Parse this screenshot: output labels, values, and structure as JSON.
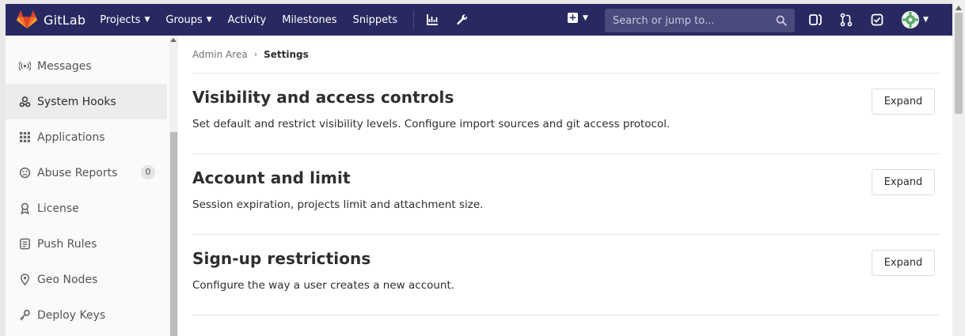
{
  "brand": {
    "name": "GitLab"
  },
  "nav": {
    "links": [
      {
        "label": "Projects",
        "caret": true
      },
      {
        "label": "Groups",
        "caret": true
      },
      {
        "label": "Activity",
        "caret": false
      },
      {
        "label": "Milestones",
        "caret": false
      },
      {
        "label": "Snippets",
        "caret": false
      }
    ],
    "icons": [
      "chart-icon",
      "wrench-icon"
    ]
  },
  "search": {
    "placeholder": "Search or jump to..."
  },
  "header_icons": [
    "issues-icon",
    "merge-requests-icon",
    "todos-icon"
  ],
  "sidebar": {
    "items": [
      {
        "label": "Messages",
        "icon": "broadcast-icon",
        "active": false
      },
      {
        "label": "System Hooks",
        "icon": "hook-icon",
        "active": true
      },
      {
        "label": "Applications",
        "icon": "grid-icon",
        "active": false
      },
      {
        "label": "Abuse Reports",
        "icon": "face-icon",
        "active": false,
        "badge": "0"
      },
      {
        "label": "License",
        "icon": "license-icon",
        "active": false
      },
      {
        "label": "Push Rules",
        "icon": "push-rules-icon",
        "active": false
      },
      {
        "label": "Geo Nodes",
        "icon": "location-icon",
        "active": false
      },
      {
        "label": "Deploy Keys",
        "icon": "key-icon",
        "active": false
      }
    ]
  },
  "breadcrumb": {
    "parent": "Admin Area",
    "current": "Settings"
  },
  "sections": [
    {
      "title": "Visibility and access controls",
      "description": "Set default and restrict visibility levels. Configure import sources and git access protocol.",
      "button": "Expand"
    },
    {
      "title": "Account and limit",
      "description": "Session expiration, projects limit and attachment size.",
      "button": "Expand"
    },
    {
      "title": "Sign-up restrictions",
      "description": "Configure the way a user creates a new account.",
      "button": "Expand"
    }
  ],
  "colors": {
    "navbar": "#292961",
    "search_bg": "#4a4a7c",
    "brand_orange": "#e24329"
  }
}
